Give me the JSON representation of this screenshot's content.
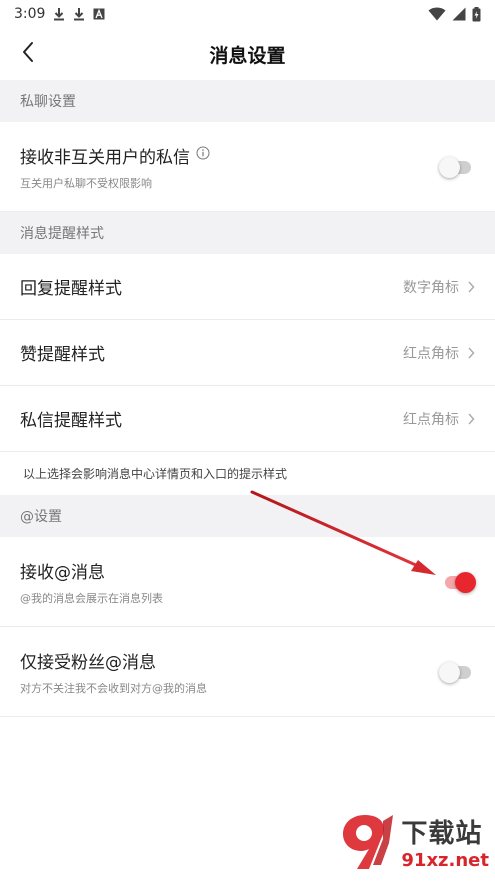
{
  "status_bar": {
    "time": "3:09",
    "icons": [
      "download-icon",
      "download-icon",
      "text-a-icon",
      "wifi-icon",
      "signal-icon",
      "battery-icon"
    ]
  },
  "header": {
    "title": "消息设置",
    "back_icon": "back-arrow-icon"
  },
  "sections": {
    "private_chat": {
      "header": "私聊设置",
      "receive_non_mutual": {
        "label": "接收非互关用户的私信",
        "info_icon": "info-icon",
        "sub": "互关用户私聊不受权限影响",
        "enabled": false
      }
    },
    "reminder_style": {
      "header": "消息提醒样式",
      "reply": {
        "label": "回复提醒样式",
        "value": "数字角标"
      },
      "like": {
        "label": "赞提醒样式",
        "value": "红点角标"
      },
      "private_msg": {
        "label": "私信提醒样式",
        "value": "红点角标"
      },
      "note": "以上选择会影响消息中心详情页和入口的提示样式"
    },
    "mention": {
      "header": "@设置",
      "receive_mention": {
        "label": "接收@消息",
        "sub": "@我的消息会展示在消息列表",
        "enabled": true
      },
      "fans_only": {
        "label": "仅接受粉丝@消息",
        "sub": "对方不关注我不会收到对方@我的消息",
        "enabled": false
      }
    }
  },
  "colors": {
    "accent": "#e8262e",
    "section_bg": "#f2f2f4",
    "annotation_arrow": "#d42a2f"
  },
  "watermark": {
    "cn": "下载站",
    "url": "91xz.net",
    "logo_icon": "site-logo-icon"
  }
}
